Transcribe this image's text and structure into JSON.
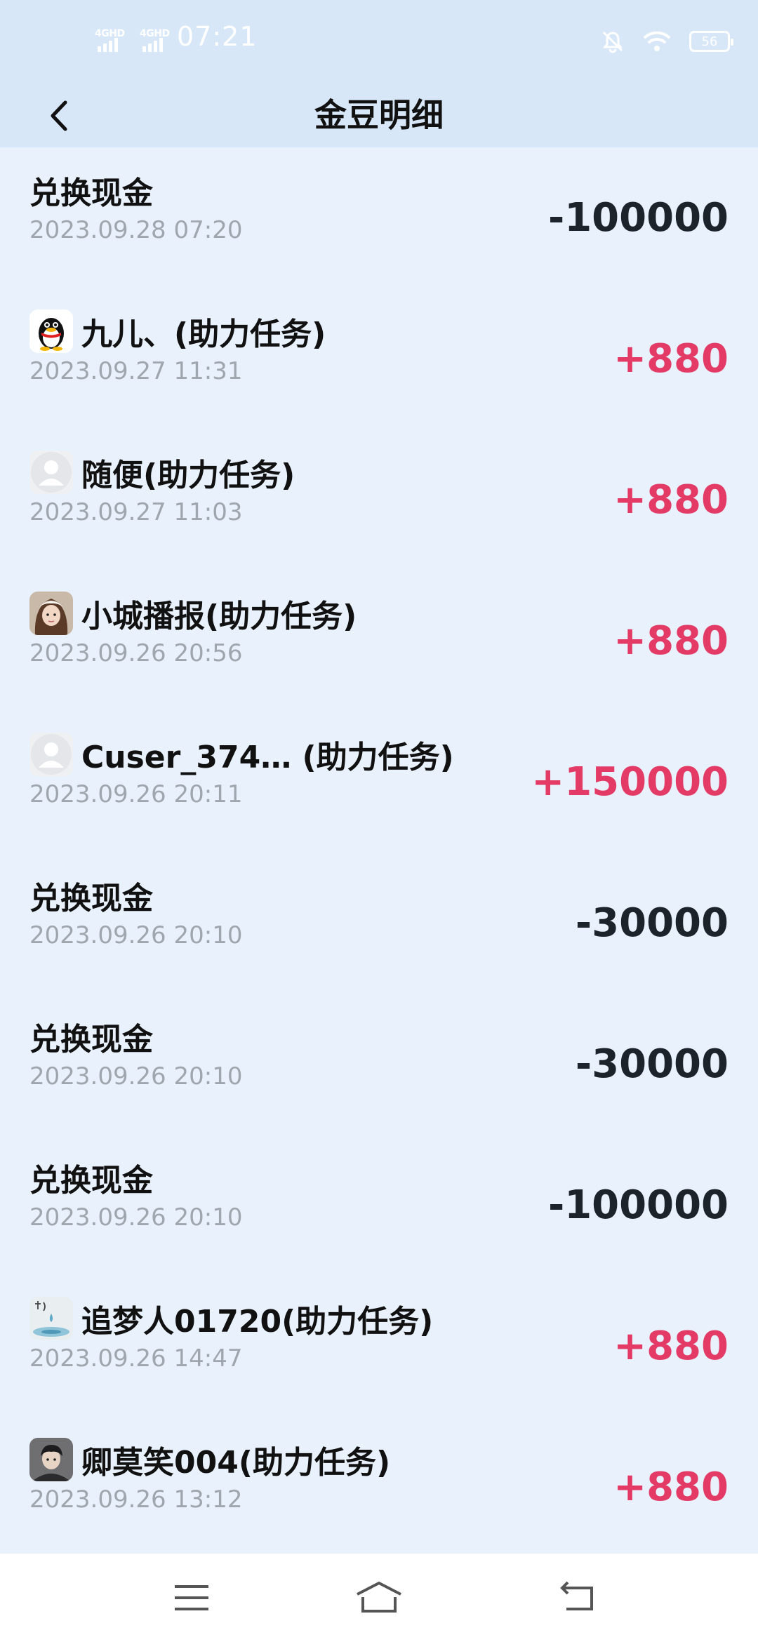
{
  "status": {
    "net1": "4GHD",
    "net2": "4GHD",
    "time": "07:21",
    "battery": "56"
  },
  "header": {
    "title": "金豆明细"
  },
  "records": [
    {
      "name": "兑换现金",
      "date": "2023.09.28 07:20",
      "amount": "-100000",
      "type": "neg",
      "avatar": "none"
    },
    {
      "name": "九儿、(助力任务)",
      "date": "2023.09.27 11:31",
      "amount": "+880",
      "type": "pos",
      "avatar": "penguin"
    },
    {
      "name": "随便(助力任务)",
      "date": "2023.09.27 11:03",
      "amount": "+880",
      "type": "pos",
      "avatar": "default"
    },
    {
      "name": "小城播报(助力任务)",
      "date": "2023.09.26 20:56",
      "amount": "+880",
      "type": "pos",
      "avatar": "photo-girl"
    },
    {
      "name": "Cuser_374… (助力任务)",
      "date": "2023.09.26 20:11",
      "amount": "+150000",
      "type": "pos",
      "avatar": "default"
    },
    {
      "name": "兑换现金",
      "date": "2023.09.26 20:10",
      "amount": "-30000",
      "type": "neg",
      "avatar": "none"
    },
    {
      "name": "兑换现金",
      "date": "2023.09.26 20:10",
      "amount": "-30000",
      "type": "neg",
      "avatar": "none"
    },
    {
      "name": "兑换现金",
      "date": "2023.09.26 20:10",
      "amount": "-100000",
      "type": "neg",
      "avatar": "none"
    },
    {
      "name": "追梦人01720(助力任务)",
      "date": "2023.09.26 14:47",
      "amount": "+880",
      "type": "pos",
      "avatar": "photo-water"
    },
    {
      "name": "卿莫笑004(助力任务)",
      "date": "2023.09.26 13:12",
      "amount": "+880",
      "type": "pos",
      "avatar": "photo-boy"
    }
  ],
  "colors": {
    "positive": "#e33a66",
    "negative": "#1d232b",
    "date": "#a0a6ad",
    "background": "#e8f1fc",
    "header": "#d7e7f8"
  },
  "icons": {
    "back": "chevron-left-icon",
    "menu": "menu-icon",
    "home": "home-icon",
    "return": "return-icon"
  }
}
